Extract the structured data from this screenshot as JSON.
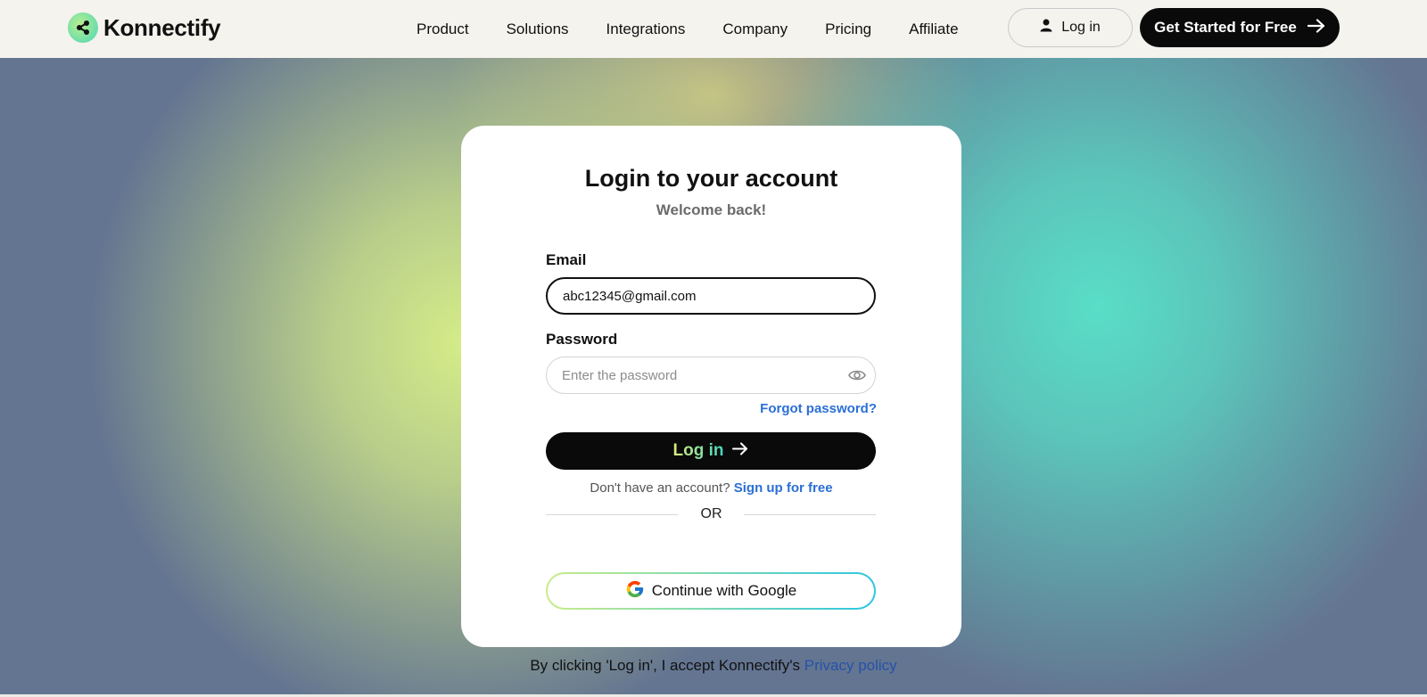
{
  "header": {
    "brand": "Konnectify",
    "nav": [
      "Product",
      "Solutions",
      "Integrations",
      "Company",
      "Pricing",
      "Affiliate"
    ],
    "login_label": "Log in",
    "cta_label": "Get Started for Free"
  },
  "login_card": {
    "title": "Login to your account",
    "subtitle": "Welcome back!",
    "email_label": "Email",
    "email_value": "abc12345@gmail.com",
    "password_label": "Password",
    "password_placeholder": "Enter the password",
    "forgot_label": "Forgot password?",
    "login_button_label": "Log in",
    "signup_prompt": "Don't have an account?",
    "signup_link": "Sign up for free",
    "or_label": "OR",
    "google_button_label": "Continue with Google"
  },
  "footer": {
    "consent_text": "By clicking 'Log in', I accept Konnectify's",
    "privacy_link": "Privacy policy"
  },
  "colors": {
    "accent_link": "#2b6fd6",
    "primary_button": "#0a0a0a",
    "gradient_start": "#d5ec88",
    "gradient_end": "#59dec8"
  },
  "icons": [
    "konnectify-logo-icon",
    "user-icon",
    "arrow-right-icon",
    "eye-icon",
    "google-icon"
  ]
}
